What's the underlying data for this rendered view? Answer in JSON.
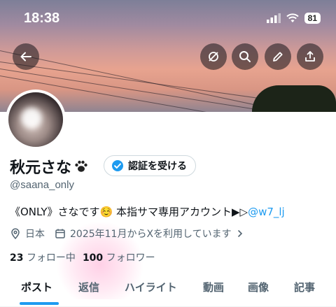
{
  "status_bar": {
    "time": "18:38",
    "battery": "81"
  },
  "profile": {
    "name": "秋元さな",
    "verify_button": "認証を受ける",
    "handle": "@saana_only",
    "bio_text": "《ONLY》さなです☺️ 本指サマ専用アカウント▶︎▷",
    "bio_link": "@w7_lj",
    "location": "日本",
    "joined": "2025年11月からXを利用しています",
    "following_count": "23",
    "following_label": "フォロー中",
    "followers_count": "100",
    "followers_label": "フォロワー"
  },
  "tabs": [
    "ポスト",
    "返信",
    "ハイライト",
    "動画",
    "画像",
    "記事"
  ],
  "colors": {
    "accent": "#1d9bf0",
    "secondary_text": "#536471"
  }
}
